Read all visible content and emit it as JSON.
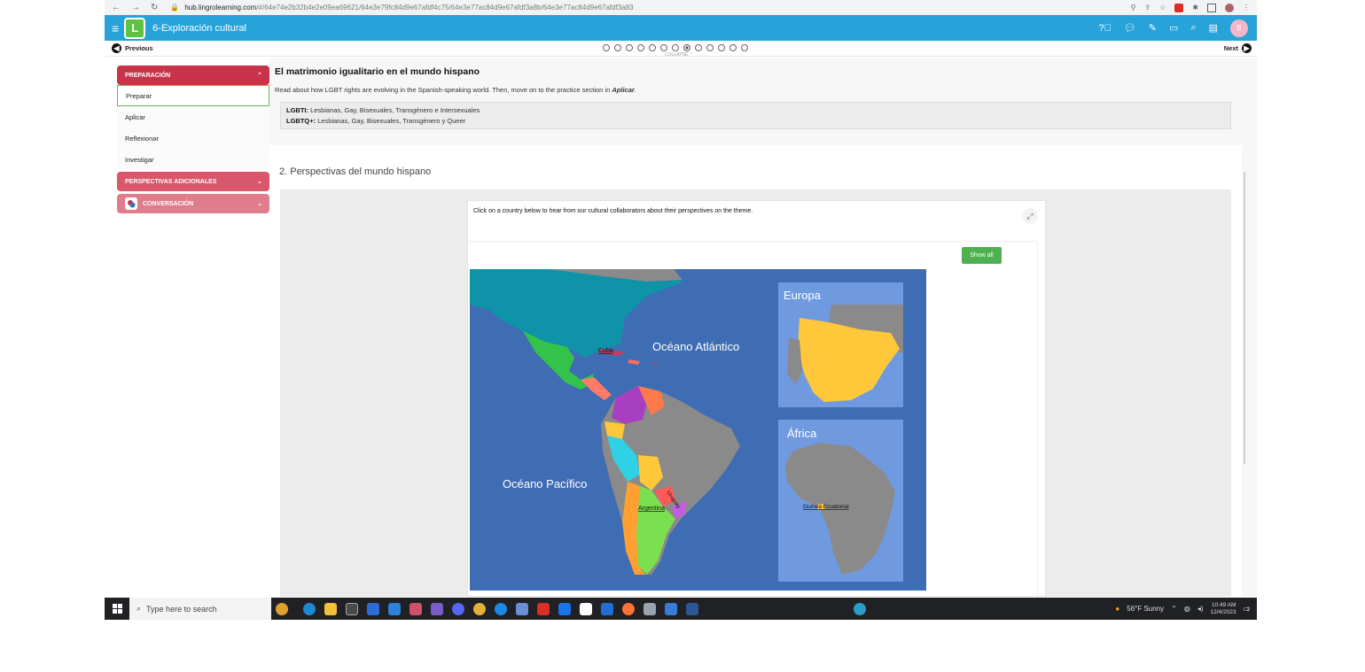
{
  "browser": {
    "url_host": "hub.lingrolearning.com",
    "url_path": "/#/64e74e2b32b4e2e09ea69621/64e3e79fc84d9e67afdf4c75/64e3e77ac84d9e67afdf3a8b/64e3e77ac84d9e67afdf3a83"
  },
  "header": {
    "title": "6-Exploración cultural",
    "avatar_initial": "B",
    "accent": "#27a3d9"
  },
  "progress": {
    "prev_label": "Previous",
    "next_label": "Next",
    "collapse_label": "COLLAPSE",
    "total_steps": 13,
    "active_step": 8
  },
  "sidebar": {
    "section1": "PREPARACIÓN",
    "items": [
      "Preparar",
      "Aplicar",
      "Reflexionar",
      "Investigar"
    ],
    "section2": "PERSPECTIVAS ADICIONALES",
    "section3": "CONVERSACIÓN"
  },
  "lesson": {
    "title": "El matrimonio igualitario en el mundo hispano",
    "intro": "Read about how LGBT rights are evolving in the Spanish-speaking world. Then, move on to the practice section in ",
    "intro_link": "Aplicar",
    "intro_end": ".",
    "def1_term": "LGBTI:",
    "def1_text": " Lesbianas, Gay, Bisexuales, Transgénero e Intersexuales",
    "def2_term": "LGBTQ+:",
    "def2_text": " Lesbianas, Gay, Bisexuales, Transgénero y Queer"
  },
  "section": {
    "title": "2. Perspectivas del mundo hispano",
    "instruction": "Click on a country below to hear from our cultural collaborators about their perspectives on the theme.",
    "show_all": "Show all"
  },
  "map": {
    "ocean_atlantic": "Océano Atlántico",
    "ocean_pacific": "Océano Pacífico",
    "inset_europe": "Europa",
    "inset_africa": "África",
    "country_cuba": "Cuba",
    "country_argentina": "Argentina",
    "country_uruguay": "Uruguay",
    "country_guinea": "Guinea Ecuatorial",
    "water_color": "#3f6db3",
    "inset_water": "#6f9ae0"
  },
  "taskbar": {
    "search_placeholder": "Type here to search",
    "weather": "56°F  Sunny",
    "time": "10:49 AM",
    "date": "12/4/2023",
    "notif_count": "2"
  }
}
